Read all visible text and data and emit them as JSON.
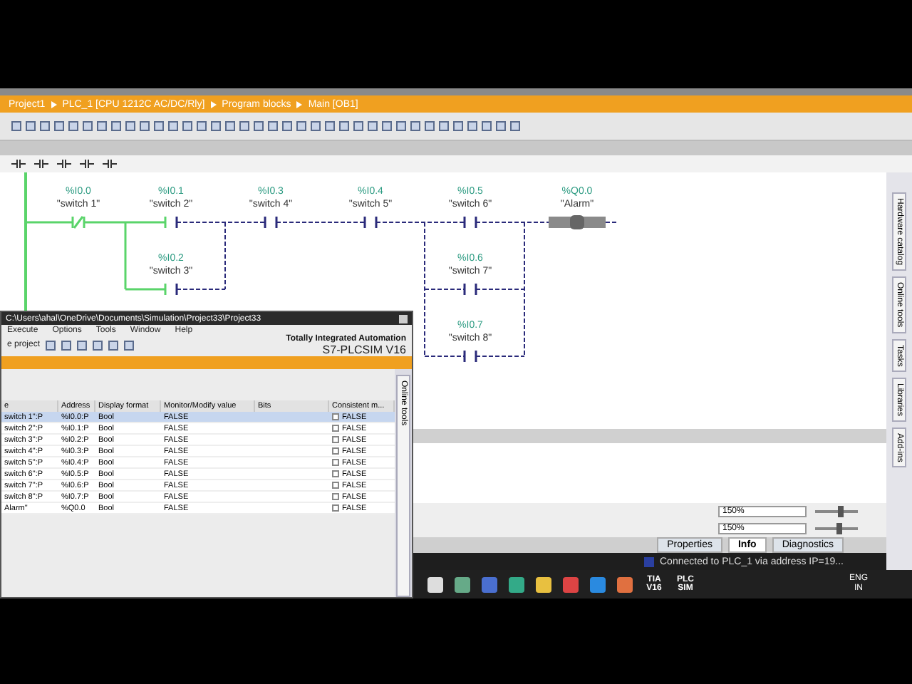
{
  "editor": {
    "breadcrumb": [
      "Project1",
      "PLC_1 [CPU 1212C AC/DC/Rly]",
      "Program blocks",
      "Main [OB1]"
    ],
    "contacts": [
      {
        "kind": "nc",
        "address": "%I0.0",
        "tag": "\"switch 1\"",
        "powered": true
      },
      {
        "kind": "no",
        "address": "%I0.1",
        "tag": "\"switch 2\"",
        "powered": true
      },
      {
        "kind": "no",
        "address": "%I0.2",
        "tag": "\"switch 3\"",
        "powered": true
      },
      {
        "kind": "no",
        "address": "%I0.3",
        "tag": "\"switch 4\"",
        "powered": false
      },
      {
        "kind": "no",
        "address": "%I0.4",
        "tag": "\"switch 5\"",
        "powered": false
      },
      {
        "kind": "no",
        "address": "%I0.5",
        "tag": "\"switch 6\"",
        "powered": false
      },
      {
        "kind": "no",
        "address": "%I0.6",
        "tag": "\"switch 7\"",
        "powered": false
      },
      {
        "kind": "no",
        "address": "%I0.7",
        "tag": "\"switch 8\"",
        "powered": false
      }
    ],
    "coil": {
      "address": "%Q0.0",
      "tag": "\"Alarm\"",
      "powered": false
    },
    "zoom_upper": {
      "value": "150%",
      "level": 0.6
    },
    "zoom_lower": {
      "value": "150%",
      "level": 0.55
    }
  },
  "side_tabs": [
    "Hardware catalog",
    "Online tools",
    "Tasks",
    "Libraries",
    "Add-ins"
  ],
  "inspector_tabs": [
    {
      "label": "Properties",
      "selected": false
    },
    {
      "label": "Info",
      "selected": true
    },
    {
      "label": "Diagnostics",
      "selected": false
    }
  ],
  "status": "Connected to PLC_1 via address IP=19...",
  "plcsim": {
    "title": "C:\\Users\\ahal\\OneDrive\\Documents\\Simulation\\Project33\\Project33",
    "menu": [
      "Execute",
      "Options",
      "Tools",
      "Window",
      "Help"
    ],
    "project_label": "e project",
    "brand": "Totally Integrated Automation",
    "product": "S7-PLCSIM V16",
    "side_tab": "Online tools",
    "columns": [
      "e",
      "Address",
      "Display format",
      "Monitor/Modify value",
      "Bits",
      "Consistent m..."
    ],
    "rows": [
      {
        "name": "switch 1\":P",
        "address": "%I0.0:P",
        "format": "Bool",
        "value": "FALSE",
        "consistent": "FALSE",
        "checked": false,
        "selected": true
      },
      {
        "name": "switch 2\":P",
        "address": "%I0.1:P",
        "format": "Bool",
        "value": "FALSE",
        "consistent": "FALSE",
        "checked": false,
        "selected": false
      },
      {
        "name": "switch 3\":P",
        "address": "%I0.2:P",
        "format": "Bool",
        "value": "FALSE",
        "consistent": "FALSE",
        "checked": false,
        "selected": false
      },
      {
        "name": "switch 4\":P",
        "address": "%I0.3:P",
        "format": "Bool",
        "value": "FALSE",
        "consistent": "FALSE",
        "checked": false,
        "selected": false
      },
      {
        "name": "switch 5\":P",
        "address": "%I0.4:P",
        "format": "Bool",
        "value": "FALSE",
        "consistent": "FALSE",
        "checked": false,
        "selected": false
      },
      {
        "name": "switch 6\":P",
        "address": "%I0.5:P",
        "format": "Bool",
        "value": "FALSE",
        "consistent": "FALSE",
        "checked": false,
        "selected": false
      },
      {
        "name": "switch 7\":P",
        "address": "%I0.6:P",
        "format": "Bool",
        "value": "FALSE",
        "consistent": "FALSE",
        "checked": false,
        "selected": false
      },
      {
        "name": "switch 8\":P",
        "address": "%I0.7:P",
        "format": "Bool",
        "value": "FALSE",
        "consistent": "FALSE",
        "checked": false,
        "selected": false
      },
      {
        "name": "Alarm\"",
        "address": "%Q0.0",
        "format": "Bool",
        "value": "FALSE",
        "consistent": "FALSE",
        "checked": false,
        "selected": false
      }
    ]
  },
  "taskbar": {
    "tiles": [
      "TIA V16",
      "PLC SIM"
    ],
    "language": "ENG",
    "region": "IN"
  }
}
